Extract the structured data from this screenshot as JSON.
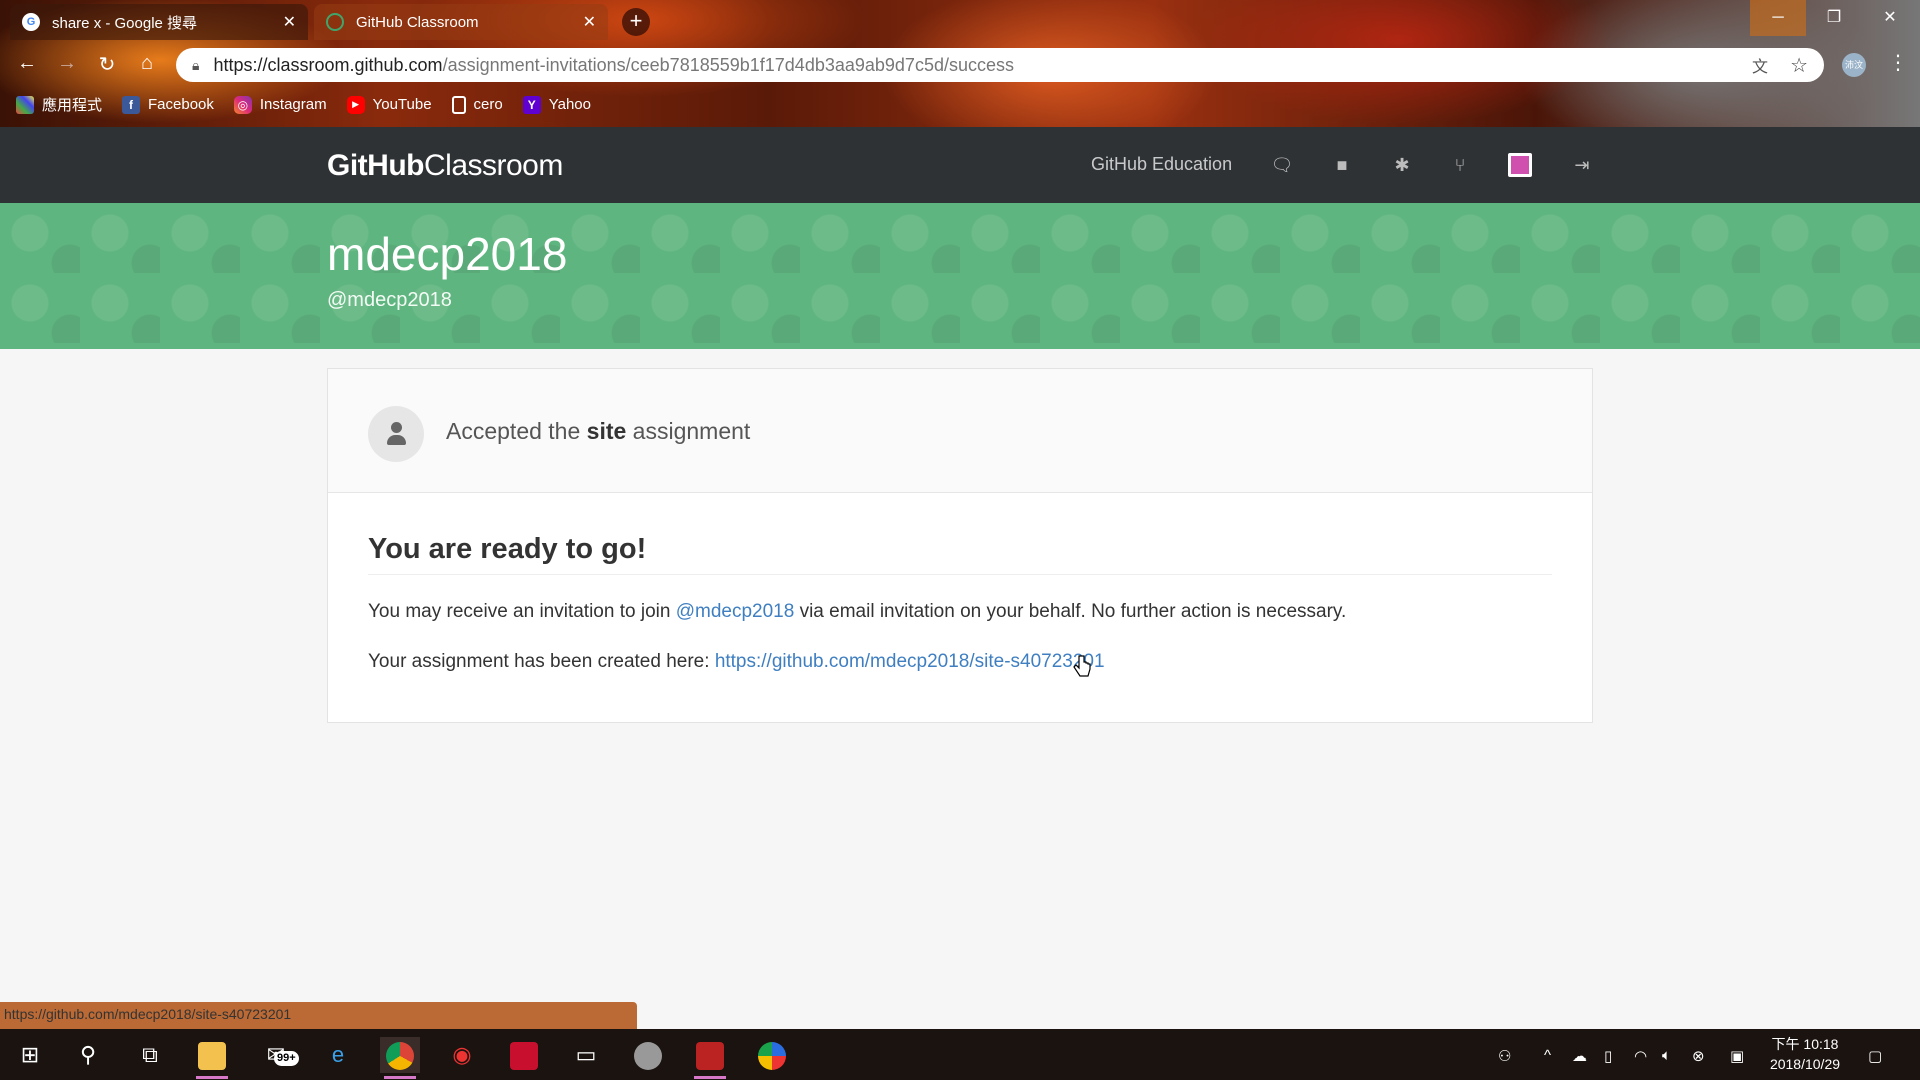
{
  "browser": {
    "tabs": [
      {
        "title": "share x - Google 搜尋",
        "active": false
      },
      {
        "title": "GitHub Classroom",
        "active": true
      }
    ],
    "url_host": "https://classroom.github.com",
    "url_path": "/assignment-invitations/ceeb7818559b1f17d4db3aa9ab9d7c5d/success",
    "profile_label": "沛汶",
    "bookmarks": [
      "應用程式",
      "Facebook",
      "Instagram",
      "YouTube",
      "cero",
      "Yahoo"
    ],
    "status_url": "https://github.com/mdecp2018/site-s40723201"
  },
  "header": {
    "logo_bold": "GitHub",
    "logo_light": "Classroom",
    "nav_link": "GitHub Education",
    "icons": [
      "comment-icon",
      "video-icon",
      "bug-icon",
      "pull-request-icon",
      "user-avatar",
      "sign-out-icon"
    ]
  },
  "banner": {
    "org_name": "mdecp2018",
    "org_handle": "@mdecp2018",
    "color": "#5fb57f"
  },
  "card": {
    "accept_prefix": "Accepted the ",
    "assignment_name": "site",
    "accept_suffix": " assignment",
    "heading": "You are ready to go!",
    "invite_prefix": "You may receive an invitation to join ",
    "invite_org": "@mdecp2018",
    "invite_suffix": " via email invitation on your behalf. No further action is necessary.",
    "created_prefix": "Your assignment has been created here: ",
    "repo_url": "https://github.com/mdecp2018/site-s40723201"
  },
  "taskbar": {
    "mail_badge": "99+",
    "clock_time": "下午 10:18",
    "clock_date": "2018/10/29"
  }
}
